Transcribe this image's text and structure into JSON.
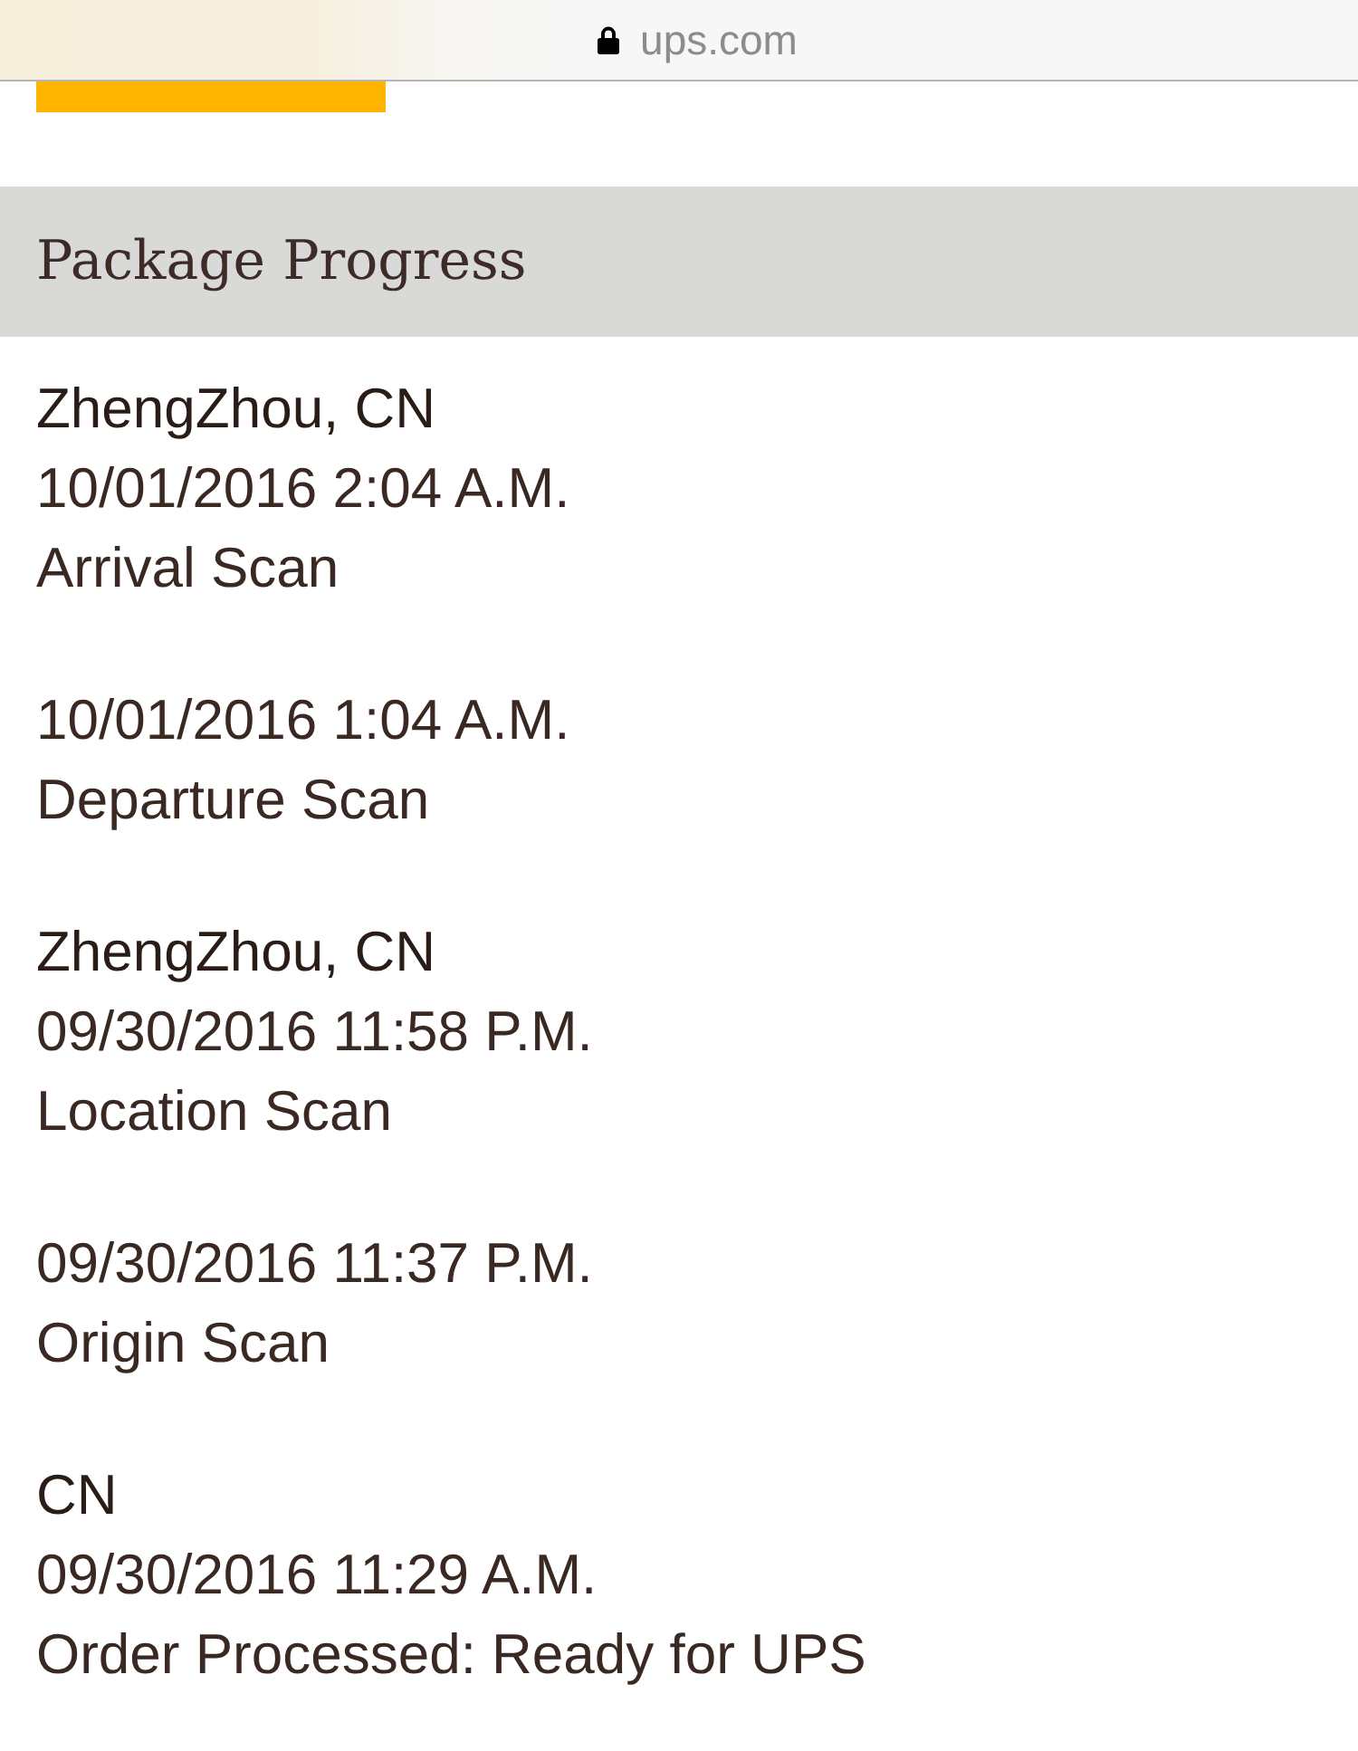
{
  "browser_bar": {
    "secure": true,
    "url": "ups.com"
  },
  "section": {
    "title": "Package Progress"
  },
  "events": [
    {
      "location": "ZhengZhou, CN",
      "datetime": "10/01/2016 2:04 A.M.",
      "activity": "Arrival Scan"
    },
    {
      "datetime": "10/01/2016 1:04 A.M.",
      "activity": "Departure Scan"
    },
    {
      "location": "ZhengZhou, CN",
      "datetime": "09/30/2016 11:58 P.M.",
      "activity": "Location Scan"
    },
    {
      "datetime": "09/30/2016 11:37 P.M.",
      "activity": "Origin Scan"
    },
    {
      "location": "CN",
      "datetime": "09/30/2016 11:29 A.M.",
      "activity": "Order Processed: Ready for UPS"
    }
  ]
}
